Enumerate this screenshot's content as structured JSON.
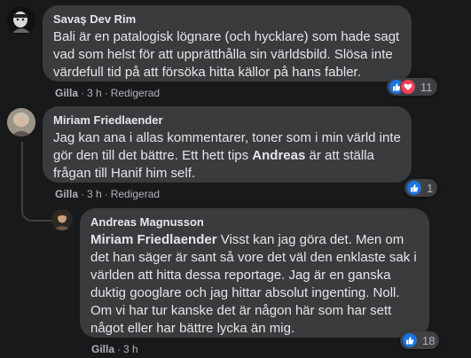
{
  "comments": [
    {
      "author": "Savaş Dev Rim",
      "text": "Bali är en patalogisk lögnare (och hycklare) som hade sagt vad som helst för att upprätthålla sin världsbild. Slösa inte värdefull tid på att försöka hitta källor på hans fabler.",
      "like_label": "Gilla",
      "time": "3 h",
      "edited": "Redigerad",
      "reactions": [
        "like",
        "love"
      ],
      "reaction_count": "11"
    },
    {
      "author": "Miriam Friedlaender",
      "text_before": "Jag kan ana i allas kommentarer, toner som i min värld inte gör den till det bättre. Ett hett tips ",
      "mention": "Andreas",
      "text_after": " är att ställa frågan till Hanif him self.",
      "like_label": "Gilla",
      "time": "3 h",
      "edited": "Redigerad",
      "reactions": [
        "like"
      ],
      "reaction_count": "1"
    },
    {
      "author": "Andreas Magnusson",
      "mention": "Miriam Friedlaender",
      "text": " Visst kan jag göra det. Men om det han säger är sant så vore det väl den enklaste sak i världen att hitta dessa reportage. Jag är en ganska duktig googlare och jag hittar absolut ingenting. Noll. Om vi har tur kanske det är någon här som har sett något eller har bättre lycka än mig.",
      "like_label": "Gilla",
      "time": "3 h",
      "reactions": [
        "like"
      ],
      "reaction_count": "18"
    }
  ],
  "colors": {
    "background": "#18191a",
    "bubble": "#3a3b3c",
    "like_blue": "#1b74e4",
    "love_red": "#f33e58",
    "reply_line": "#3e4042"
  }
}
